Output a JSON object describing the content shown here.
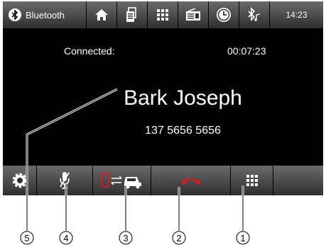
{
  "topbar": {
    "bluetooth_label": "Bluetooth",
    "time": "14:23",
    "icons": [
      "bluetooth-icon",
      "home-icon",
      "phonebook-icon",
      "keypad-icon",
      "radio-icon",
      "clock-icon",
      "bluetooth-music-icon"
    ]
  },
  "call": {
    "status_label": "Connected:",
    "duration": "00:07:23",
    "contact_name": "Bark Joseph",
    "phone_number": "137 5656 5656"
  },
  "bottombar": {
    "buttons": [
      "settings",
      "mute-microphone",
      "switch-audio-to-phone",
      "hang-up",
      "keypad"
    ]
  },
  "callouts": {
    "labels": [
      "5",
      "4",
      "3",
      "2",
      "1"
    ]
  },
  "colors": {
    "background": "#000000",
    "button_gradient_top": "#6b6b6b",
    "button_gradient_bottom": "#2e2e2e",
    "hangup_red": "#e8161b",
    "text": "#ffffff"
  }
}
